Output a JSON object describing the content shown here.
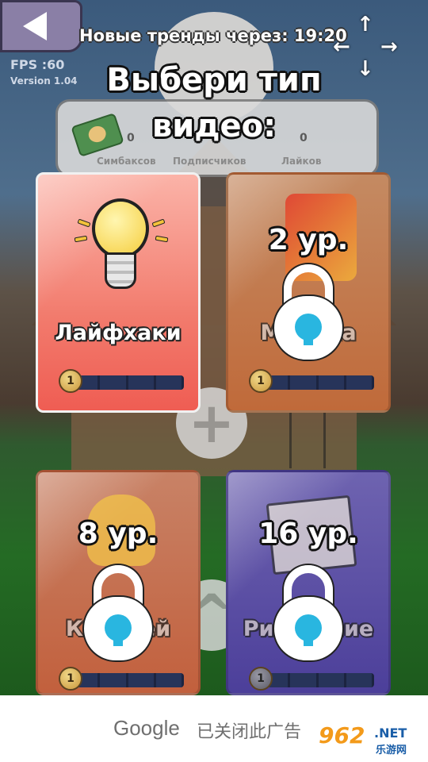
{
  "header": {
    "timer_text": "Новые тренды через: 19:20",
    "fps_text": "FPS :60",
    "version_text": "Version 1.04",
    "title_line1": "Выбери тип",
    "title_line2": "видео:"
  },
  "stats": [
    {
      "value": "0",
      "label": "Симбаксов"
    },
    {
      "value": "0",
      "label": "Подписчиков"
    },
    {
      "value": "0",
      "label": "Лайков"
    }
  ],
  "cards": [
    {
      "name": "Лайфхаки",
      "locked": false,
      "coin_level": "1",
      "icon": "lightbulb-icon"
    },
    {
      "name": "Музыка",
      "locked": true,
      "level_label": "2 ур.",
      "coin_level": "1",
      "icon": "music-note-icon"
    },
    {
      "name": "Косплей",
      "locked": true,
      "level_label": "8 ур.",
      "coin_level": "1",
      "icon": "cat-ears-icon"
    },
    {
      "name": "Рисование",
      "locked": true,
      "level_label": "16 ур.",
      "coin_level": "1",
      "icon": "easel-icon"
    }
  ],
  "ad": {
    "brand": "Google",
    "closed_text": "已关闭此广告"
  },
  "watermark": {
    "number": "962",
    "domain": ".NET",
    "chinese": "乐游网"
  },
  "colors": {
    "lock_keyhole": "#29b6e0",
    "card_active": "#ef5d53",
    "card_music": "#c06a3a",
    "card_cosplay": "#c2603d",
    "card_drawing": "#4c3f9a"
  }
}
